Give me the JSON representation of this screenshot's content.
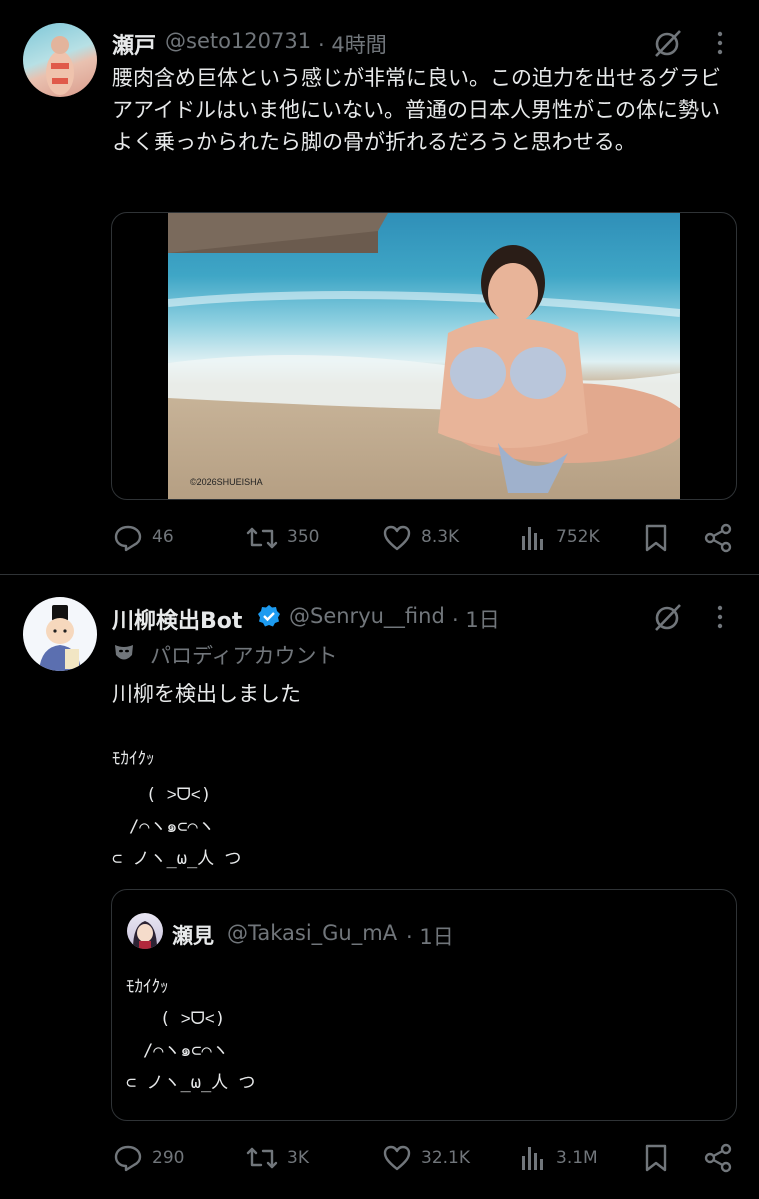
{
  "tweet1": {
    "name": "瀬戸",
    "handle": "@seto120731",
    "time": "· 4時間",
    "text": "腰肉含め巨体という感じが非常に良い。この迫力を出せるグラビアアイドルはいま他にいない。普通の日本人男性がこの体に勢いよく乗っかられたら脚の骨が折れるだろうと思わせる。",
    "image_watermark": "©2026SHUEISHA",
    "stats": {
      "replies": "46",
      "retweets": "350",
      "likes": "8.3K",
      "views": "752K"
    }
  },
  "tweet2": {
    "name": "川柳検出Bot",
    "handle": "@Senryu__find",
    "time": "· 1日",
    "parody_label": "パロディアカウント",
    "text": "川柳を検出しました",
    "aa_lines": [
      "ﾓｶｲｸｯ",
      "　　( ˃ᗜ˂)",
      "　/⌒ヽ๑⊂⌒ヽ",
      "⊂ ノヽ_ω_人 つ"
    ],
    "quote": {
      "name": "瀬見",
      "handle": "@Takasi_Gu_mA",
      "time": "· 1日",
      "aa_lines": [
        "ﾓｶｲｸｯ",
        "　　( ˃ᗜ˂)",
        "　/⌒ヽ๑⊂⌒ヽ",
        "⊂ ノヽ_ω_人 つ"
      ]
    },
    "stats": {
      "replies": "290",
      "retweets": "3K",
      "likes": "32.1K",
      "views": "3.1M"
    }
  },
  "colors": {
    "background": "#000000",
    "text": "#e7e9ea",
    "muted": "#71767b",
    "verified": "#1d9bf0",
    "divider": "#2f3336"
  }
}
